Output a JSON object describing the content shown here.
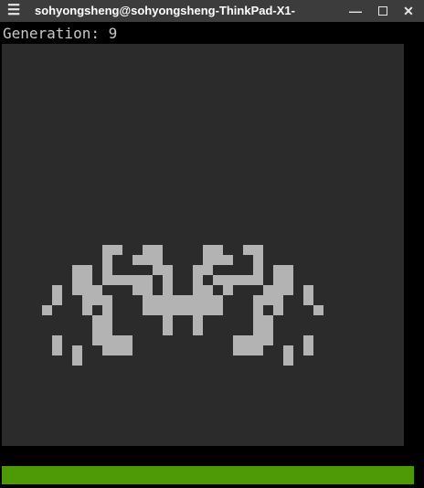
{
  "window": {
    "title": "sohyongsheng@sohyongsheng-ThinkPad-X1-",
    "menu_icon": "hamburger-menu-icon",
    "minimize_icon": "minimize-icon",
    "maximize_icon": "maximize-icon",
    "close_icon": "close-icon"
  },
  "terminal": {
    "generation_label": "Generation:",
    "generation_value": "9"
  },
  "colors": {
    "background": "#000000",
    "grid_background": "#2b2b2b",
    "live_cell": "#b3b3b3",
    "status_bar": "#4e9a06",
    "titlebar": "#3c3c3c"
  },
  "grid": {
    "cols": 40,
    "rows": 40,
    "live_cells": [
      [
        20,
        10
      ],
      [
        20,
        11
      ],
      [
        20,
        14
      ],
      [
        20,
        15
      ],
      [
        20,
        20
      ],
      [
        20,
        21
      ],
      [
        20,
        24
      ],
      [
        20,
        25
      ],
      [
        21,
        10
      ],
      [
        21,
        13
      ],
      [
        21,
        14
      ],
      [
        21,
        15
      ],
      [
        21,
        20
      ],
      [
        21,
        21
      ],
      [
        21,
        22
      ],
      [
        21,
        25
      ],
      [
        22,
        7
      ],
      [
        22,
        8
      ],
      [
        22,
        10
      ],
      [
        22,
        15
      ],
      [
        22,
        16
      ],
      [
        22,
        19
      ],
      [
        22,
        20
      ],
      [
        22,
        25
      ],
      [
        22,
        27
      ],
      [
        22,
        28
      ],
      [
        23,
        7
      ],
      [
        23,
        8
      ],
      [
        23,
        10
      ],
      [
        23,
        11
      ],
      [
        23,
        12
      ],
      [
        23,
        13
      ],
      [
        23,
        14
      ],
      [
        23,
        16
      ],
      [
        23,
        19
      ],
      [
        23,
        21
      ],
      [
        23,
        22
      ],
      [
        23,
        23
      ],
      [
        23,
        24
      ],
      [
        23,
        25
      ],
      [
        23,
        27
      ],
      [
        23,
        28
      ],
      [
        24,
        5
      ],
      [
        24,
        7
      ],
      [
        24,
        8
      ],
      [
        24,
        9
      ],
      [
        24,
        13
      ],
      [
        24,
        14
      ],
      [
        24,
        16
      ],
      [
        24,
        19
      ],
      [
        24,
        20
      ],
      [
        24,
        22
      ],
      [
        24,
        26
      ],
      [
        24,
        27
      ],
      [
        24,
        28
      ],
      [
        24,
        30
      ],
      [
        25,
        5
      ],
      [
        25,
        8
      ],
      [
        25,
        9
      ],
      [
        25,
        10
      ],
      [
        25,
        14
      ],
      [
        25,
        15
      ],
      [
        25,
        16
      ],
      [
        25,
        17
      ],
      [
        25,
        18
      ],
      [
        25,
        19
      ],
      [
        25,
        20
      ],
      [
        25,
        21
      ],
      [
        25,
        25
      ],
      [
        25,
        26
      ],
      [
        25,
        27
      ],
      [
        25,
        30
      ],
      [
        26,
        4
      ],
      [
        26,
        8
      ],
      [
        26,
        10
      ],
      [
        26,
        14
      ],
      [
        26,
        15
      ],
      [
        26,
        16
      ],
      [
        26,
        17
      ],
      [
        26,
        18
      ],
      [
        26,
        19
      ],
      [
        26,
        20
      ],
      [
        26,
        21
      ],
      [
        26,
        25
      ],
      [
        26,
        27
      ],
      [
        26,
        31
      ],
      [
        27,
        9
      ],
      [
        27,
        10
      ],
      [
        27,
        16
      ],
      [
        27,
        19
      ],
      [
        27,
        25
      ],
      [
        27,
        26
      ],
      [
        28,
        9
      ],
      [
        28,
        10
      ],
      [
        28,
        16
      ],
      [
        28,
        19
      ],
      [
        28,
        25
      ],
      [
        28,
        26
      ],
      [
        29,
        5
      ],
      [
        29,
        9
      ],
      [
        29,
        10
      ],
      [
        29,
        11
      ],
      [
        29,
        12
      ],
      [
        29,
        23
      ],
      [
        29,
        24
      ],
      [
        29,
        25
      ],
      [
        29,
        26
      ],
      [
        29,
        30
      ],
      [
        30,
        5
      ],
      [
        30,
        7
      ],
      [
        30,
        10
      ],
      [
        30,
        11
      ],
      [
        30,
        12
      ],
      [
        30,
        23
      ],
      [
        30,
        24
      ],
      [
        30,
        25
      ],
      [
        30,
        28
      ],
      [
        30,
        30
      ],
      [
        31,
        7
      ],
      [
        31,
        28
      ]
    ]
  }
}
